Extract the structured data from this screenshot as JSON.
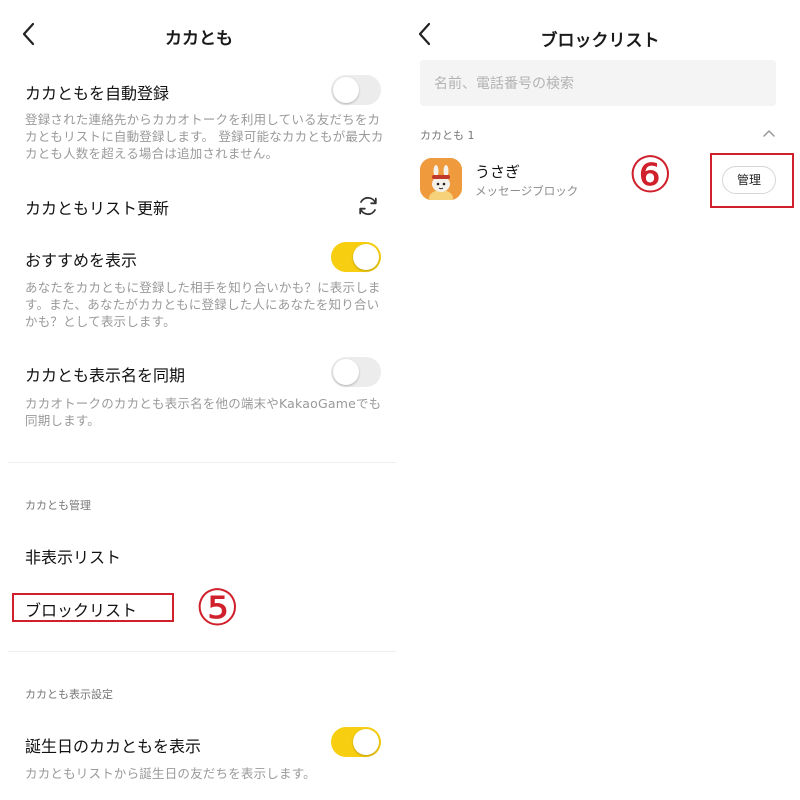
{
  "left": {
    "title": "カカとも",
    "auto_add": {
      "label": "カカともを自動登録",
      "desc": "登録された連絡先からカカオトークを利用している友だちをカカともリストに自動登録します。 登録可能なカカともが最大カカとも人数を超える場合は追加されません。",
      "enabled": false
    },
    "refresh": {
      "label": "カカともリスト更新",
      "icon": "refresh-icon"
    },
    "recommend": {
      "label": "おすすめを表示",
      "desc": "あなたをカカともに登録した相手を知り合いかも？に表示します。また、あなたがカカともに登録した人にあなたを知り合いかも？として表示します。",
      "enabled": true
    },
    "sync_name": {
      "label": "カカとも表示名を同期",
      "desc": "カカオトークのカカとも表示名を他の端末やKakaoGameでも同期します。",
      "enabled": false
    },
    "manage_section": {
      "header": "カカとも管理",
      "hidden_list": "非表示リスト",
      "block_list": "ブロックリスト",
      "step_marker": "⑤"
    },
    "display_section": {
      "header": "カカとも表示設定",
      "birthday": {
        "label": "誕生日のカカともを表示",
        "desc": "カカともリストから誕生日の友だちを表示します。",
        "enabled": true
      }
    }
  },
  "right": {
    "title": "ブロックリスト",
    "search": {
      "placeholder": "名前、電話番号の検索"
    },
    "list_header": "カカとも 1",
    "items": [
      {
        "name": "うさぎ",
        "status": "メッセージブロック",
        "action": "管理"
      }
    ],
    "step_marker": "⑥"
  },
  "colors": {
    "accent": "#f8cf10",
    "annotation": "#d0202b"
  }
}
